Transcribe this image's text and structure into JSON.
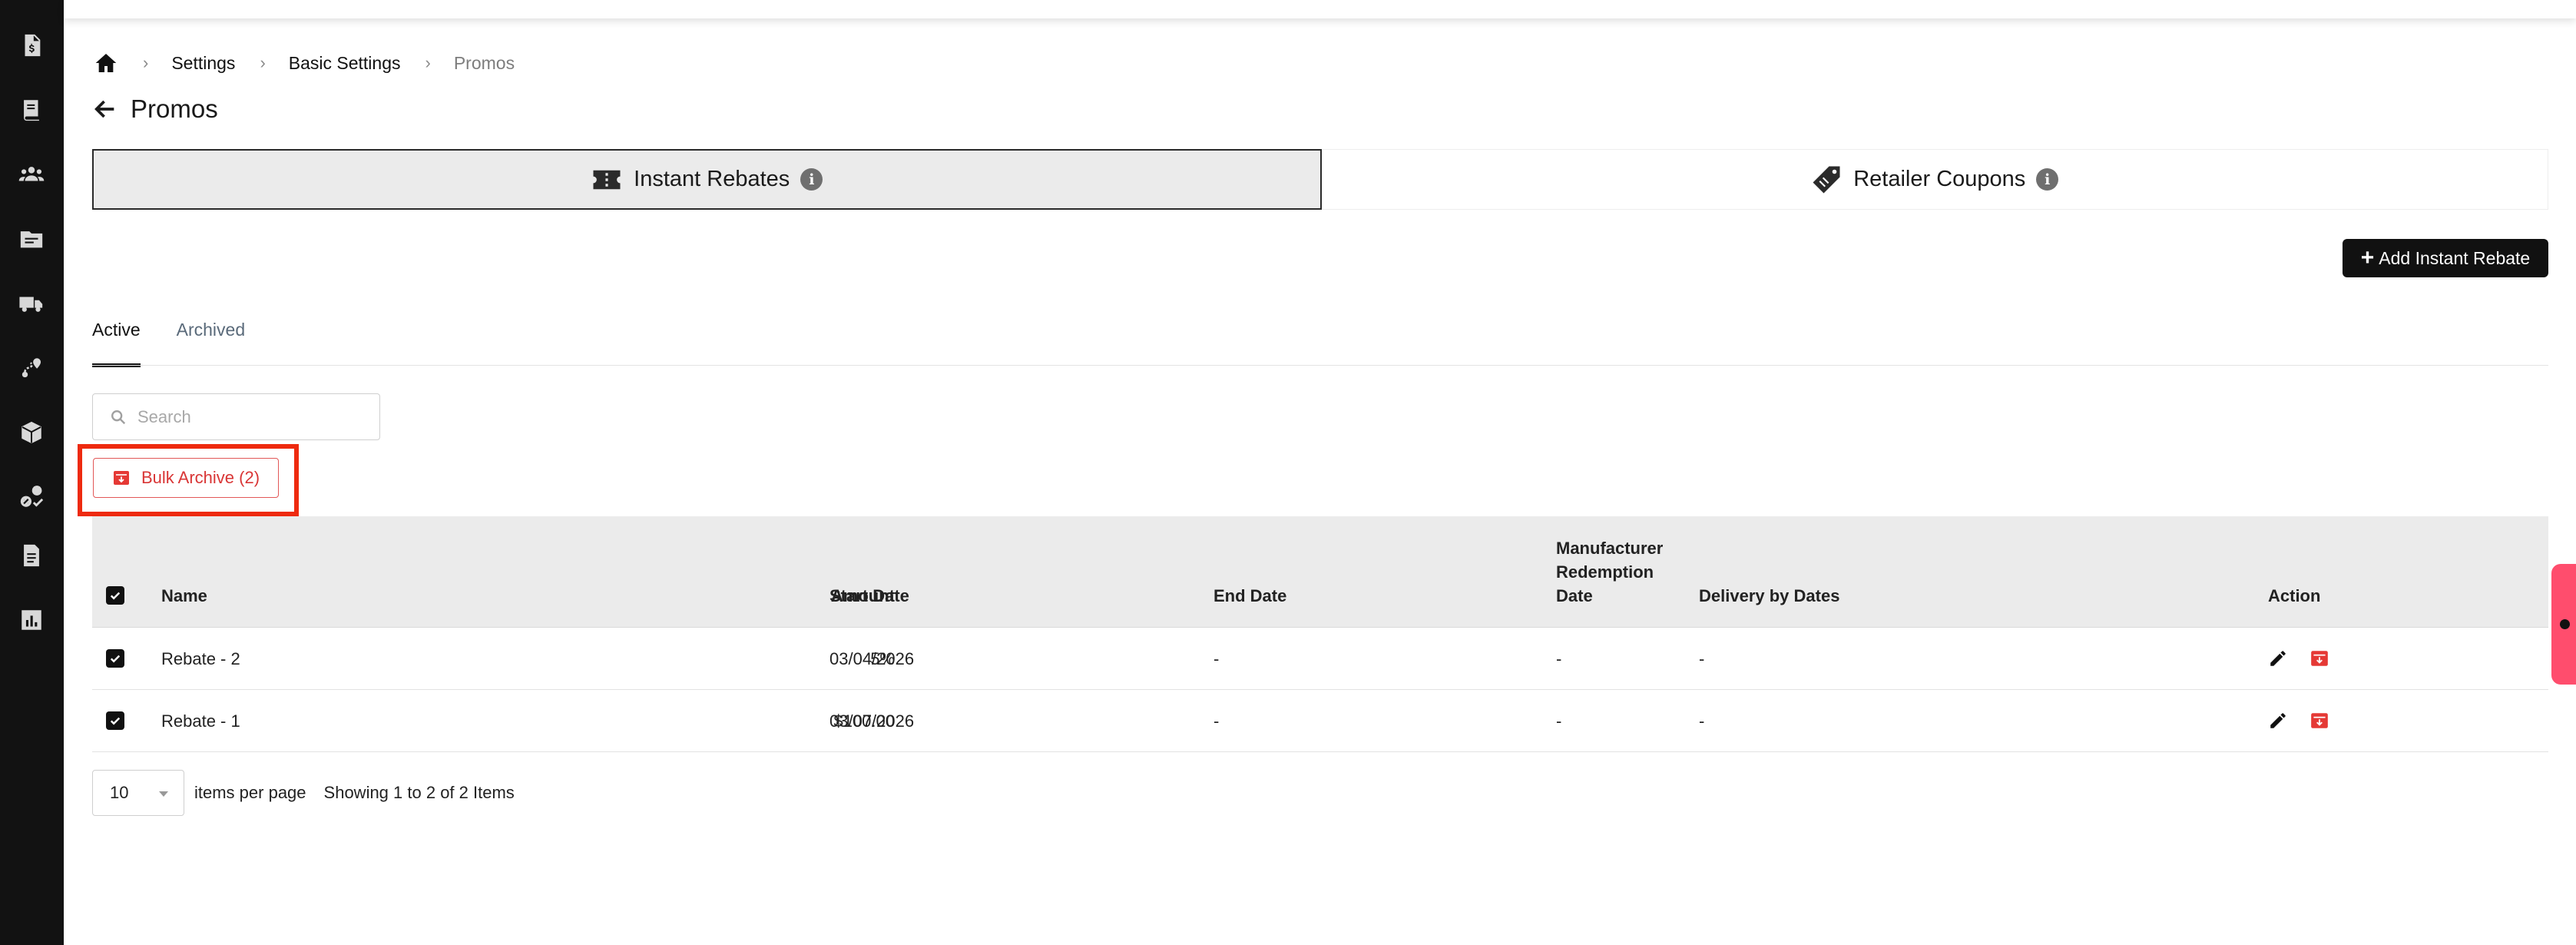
{
  "sidebar": {
    "items": [
      {
        "icon": "invoice-dollar-icon"
      },
      {
        "icon": "book-icon"
      },
      {
        "icon": "users-icon"
      },
      {
        "icon": "folder-icon"
      },
      {
        "icon": "truck-icon"
      },
      {
        "icon": "route-icon"
      },
      {
        "icon": "box-icon"
      },
      {
        "icon": "promotion-check-icon"
      },
      {
        "icon": "document-icon"
      },
      {
        "icon": "chart-icon"
      }
    ]
  },
  "breadcrumb": {
    "items": [
      "Settings",
      "Basic Settings",
      "Promos"
    ]
  },
  "page": {
    "title": "Promos"
  },
  "promo_tabs": [
    {
      "label": "Instant Rebates",
      "icon": "ticket-icon",
      "active": true
    },
    {
      "label": "Retailer Coupons",
      "icon": "coupon-tag-icon",
      "active": false
    }
  ],
  "toolbar": {
    "add_label": "Add Instant Rebate"
  },
  "status_tabs": [
    {
      "label": "Active",
      "active": true
    },
    {
      "label": "Archived",
      "active": false
    }
  ],
  "search": {
    "placeholder": "Search",
    "value": ""
  },
  "bulk_archive": {
    "label": "Bulk Archive (2)"
  },
  "table": {
    "headers": {
      "name": "Name",
      "amount": "Amount",
      "start_date": "Start Date",
      "end_date": "End Date",
      "manufacturer_line1": "Manufacturer",
      "manufacturer_line2": "Redemption",
      "manufacturer_line3": "Date",
      "delivery": "Delivery by Dates",
      "action": "Action"
    },
    "rows": [
      {
        "name": "Rebate - 2",
        "amount": "5%",
        "start_date": "03/04/2026",
        "end_date": "-",
        "manufacturer_redemption_date": "-",
        "delivery_by_dates": "-",
        "checked": true
      },
      {
        "name": "Rebate - 1",
        "amount": "$100.00",
        "start_date": "03/07/2026",
        "end_date": "-",
        "manufacturer_redemption_date": "-",
        "delivery_by_dates": "-",
        "checked": true
      }
    ]
  },
  "pagination": {
    "page_size": "10",
    "items_per_page_label": "items per page",
    "showing": "Showing 1 to 2 of 2 Items"
  },
  "colors": {
    "sidebar_bg": "#121212",
    "accent_red": "#d93636",
    "highlight": "#ee2a0f",
    "feedback_tab": "#ff4d6d"
  }
}
